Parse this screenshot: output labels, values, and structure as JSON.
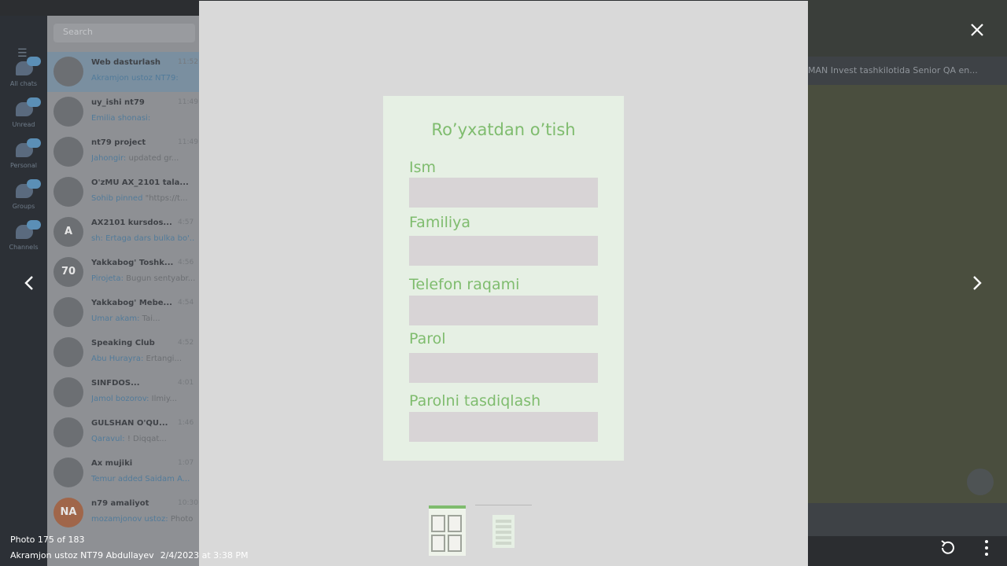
{
  "app": {
    "search_placeholder": "Search",
    "folders": [
      {
        "label": "All chats",
        "icon": "chat-bubble-icon"
      },
      {
        "label": "Unread",
        "icon": "chat-bubble-icon"
      },
      {
        "label": "Personal",
        "icon": "chat-bubble-icon"
      },
      {
        "label": "Groups",
        "icon": "people-icon"
      },
      {
        "label": "Channels",
        "icon": "megaphone-icon"
      }
    ],
    "chats": [
      {
        "title": "Web dasturlash",
        "preview_sender": "Akramjon ustoz NT79:",
        "preview": "",
        "time": "11:52",
        "avatar": ""
      },
      {
        "title": "uy_ishi nt79",
        "preview_sender": "Emilia shonasi:",
        "preview": "",
        "time": "11:49",
        "avatar": ""
      },
      {
        "title": "nt79 project",
        "preview_sender": "Jahongir:",
        "preview": "updated gr...",
        "time": "11:49",
        "avatar": ""
      },
      {
        "title": "O'zMU AX_2101 tala...",
        "preview_sender": "Sohib pinned",
        "preview": "\"https://t...",
        "time": "",
        "avatar": ""
      },
      {
        "title": "AX2101 kursdos...",
        "preview_sender": "sh: Ertaga dars bulka bo'...",
        "preview": "",
        "time": "4:57",
        "avatar": "A"
      },
      {
        "title": "Yakkabog' Toshk...",
        "preview_sender": "Pirojeta:",
        "preview": "Bugun sentyabr...",
        "time": "4:56",
        "avatar": "70"
      },
      {
        "title": "Yakkabog' Mebe...",
        "preview_sender": "Umar akam:",
        "preview": "Tai...",
        "time": "4:54",
        "avatar": ""
      },
      {
        "title": "Speaking Club",
        "preview_sender": "Abu Hurayra:",
        "preview": "Ertangi...",
        "time": "4:52",
        "avatar": ""
      },
      {
        "title": "SINFDOS...",
        "preview_sender": "Jamol bozorov:",
        "preview": "Ilmiy...",
        "time": "4:01",
        "avatar": ""
      },
      {
        "title": "GULSHAN O'QU...",
        "preview_sender": "Qaravul:",
        "preview": "! Diqqat...",
        "time": "1:46",
        "avatar": ""
      },
      {
        "title": "Ax mujiki",
        "preview_sender": "Temur added Saidam A...",
        "preview": "",
        "time": "1:07",
        "avatar": ""
      },
      {
        "title": "n79 amaliyot",
        "preview_sender": "mozamjonov ustoz:",
        "preview": "Photo",
        "time": "10:30",
        "avatar": "NA"
      }
    ],
    "pinned_text": "MAN Invest tashkilotida Senior QA en..."
  },
  "viewer": {
    "photo": {
      "title": "Ro’yxatdan o’tish",
      "fields": [
        {
          "label": "Ism"
        },
        {
          "label": "Familiya"
        },
        {
          "label": "Telefon raqami"
        },
        {
          "label": "Parol"
        },
        {
          "label": "Parolni tasdiqlash"
        }
      ]
    },
    "counter": "Photo 175 of 183",
    "sender": "Akramjon ustoz NT79 Abdullayev",
    "timestamp": "2/4/2023 at 3:38 PM",
    "icons": {
      "close": "close-icon",
      "prev": "chevron-left-icon",
      "next": "chevron-right-icon",
      "rotate": "rotate-icon",
      "menu": "more-vertical-icon"
    },
    "colors": {
      "viewer_bg": "#d9d9d9",
      "form_bg": "#e6f0e4",
      "form_text": "#7fbc6e",
      "field_bg": "#d8d4d6"
    }
  }
}
